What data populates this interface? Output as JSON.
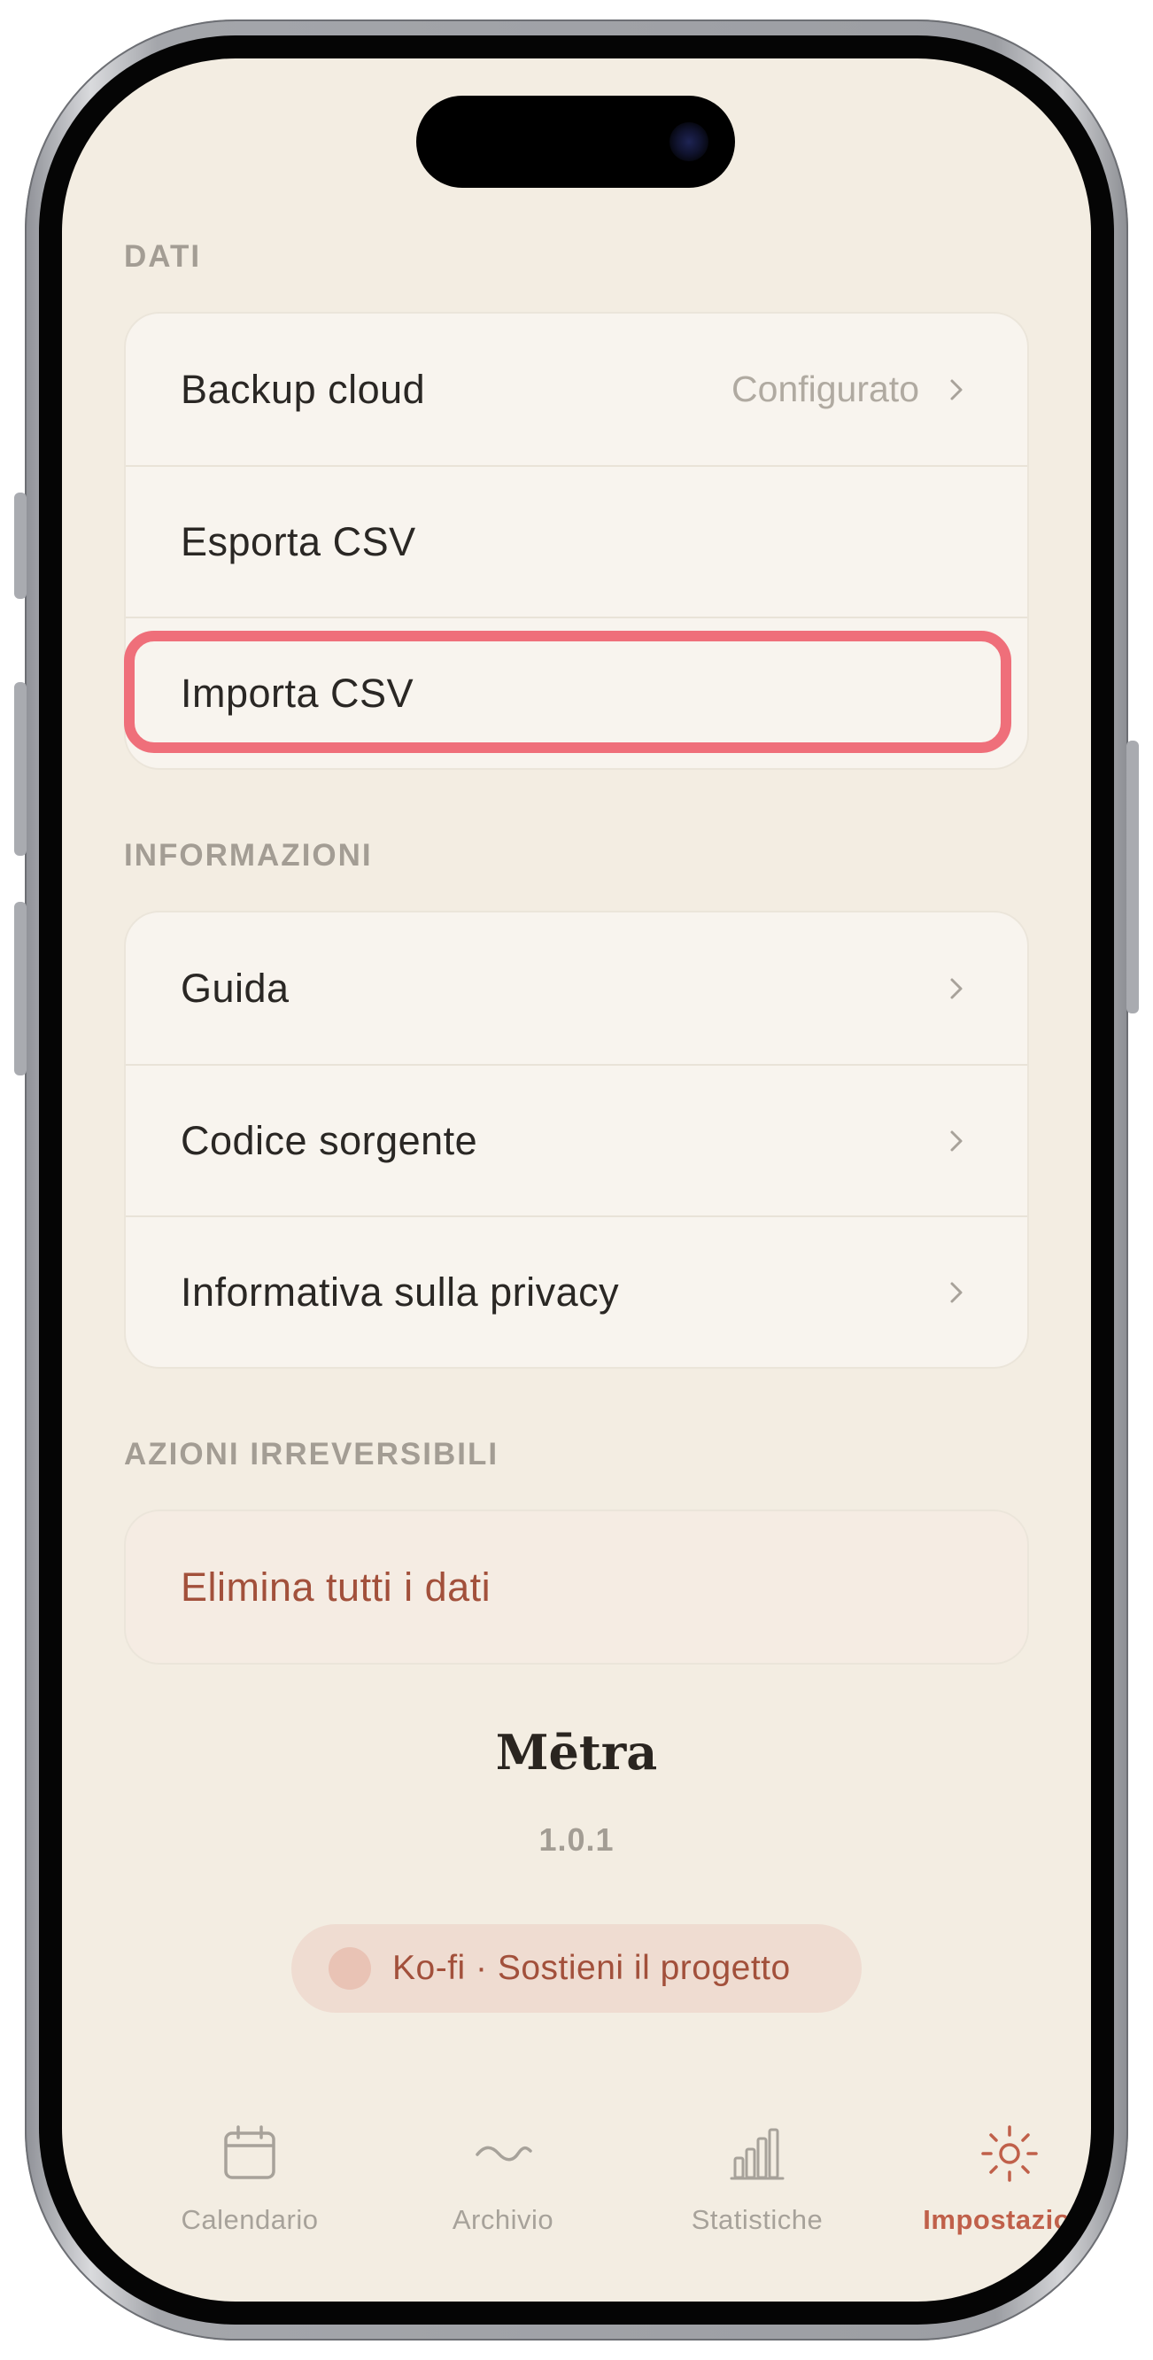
{
  "sections": {
    "data": {
      "title": "DATI",
      "items": [
        {
          "label": "Backup cloud",
          "value": "Configurato"
        },
        {
          "label": "Esporta CSV"
        },
        {
          "label": "Importa CSV"
        }
      ]
    },
    "info": {
      "title": "INFORMAZIONI",
      "items": [
        {
          "label": "Guida"
        },
        {
          "label": "Codice sorgente"
        },
        {
          "label": "Informativa sulla privacy"
        }
      ]
    },
    "danger": {
      "title": "AZIONI IRREVERSIBILI",
      "items": [
        {
          "label": "Elimina tutti i dati"
        }
      ]
    }
  },
  "app": {
    "name": "Mētra",
    "version": "1.0.1"
  },
  "kofi": {
    "label": "Ko-fi · Sostieni il progetto"
  },
  "tabbar": {
    "tabs": [
      {
        "label": "Calendario",
        "icon": "calendar-icon",
        "active": false
      },
      {
        "label": "Archivio",
        "icon": "wave-icon",
        "active": false
      },
      {
        "label": "Statistiche",
        "icon": "bar-chart-icon",
        "active": false
      },
      {
        "label": "Impostazioni",
        "icon": "sun-icon",
        "active": true
      }
    ]
  },
  "colors": {
    "background": "#f3ede2",
    "card": "#f8f4ee",
    "accent": "#c0604a",
    "danger_text": "#a2503b",
    "highlight": "#ef6f7a"
  }
}
